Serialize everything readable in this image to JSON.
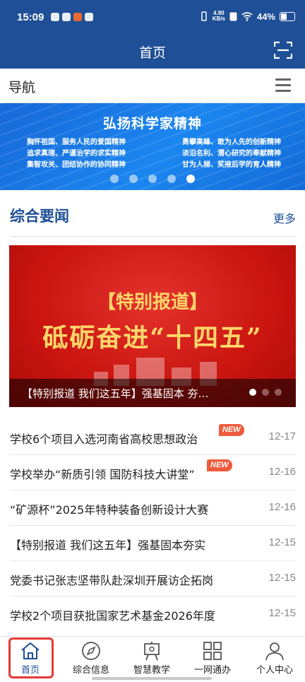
{
  "status_bar": {
    "time": "15:09",
    "network_speed": "4.90\nKB/s",
    "battery": "44%"
  },
  "header": {
    "title": "首页"
  },
  "nav": {
    "label": "导航"
  },
  "banner": {
    "title": "弘扬科学家精神",
    "lines": [
      [
        "胸怀祖国、服务人民的爱国精神",
        "勇攀高峰、敢为人先的创新精神"
      ],
      [
        "追求真理、严谨治学的求实精神",
        "淡泊名利、潜心研究的奉献精神"
      ],
      [
        "集智攻关、团结协作的协同精神",
        "甘为人梯、奖掖后学的育人精神"
      ]
    ]
  },
  "section": {
    "title": "综合要闻",
    "more": "更多"
  },
  "featured": {
    "tag": "【特别报道】",
    "headline": "砥砺奋进“十四五”",
    "caption": "【特别报道 我们这五年】强基固本 夯实根基"
  },
  "news": [
    {
      "title": "学校6个项目入选河南省高校思想政治",
      "date": "12-17",
      "badge": "NEW"
    },
    {
      "title": "学校举办“新质引领 国防科技大讲堂”",
      "date": "12-16",
      "badge": "NEW"
    },
    {
      "title": "“矿源杯”2025年特种装备创新设计大赛",
      "date": "12-16"
    },
    {
      "title": "【特别报道 我们这五年】强基固本夯实",
      "date": "12-15"
    },
    {
      "title": "党委书记张志坚带队赴深圳开展访企拓岗",
      "date": "12-15"
    },
    {
      "title": "学校2个项目获批国家艺术基金2026年度",
      "date": "12-15"
    }
  ],
  "tabs": [
    {
      "label": "首页",
      "icon": "home-icon"
    },
    {
      "label": "综合信息",
      "icon": "compass-icon"
    },
    {
      "label": "智慧教学",
      "icon": "easel-icon"
    },
    {
      "label": "一网通办",
      "icon": "grid-icon"
    },
    {
      "label": "个人中心",
      "icon": "person-icon"
    }
  ],
  "colors": {
    "primary": "#1f4f96",
    "banner": "#1b86ef",
    "feature_red": "#c9140f",
    "badge": "#ef5b3d",
    "highlight": "#e53935"
  }
}
